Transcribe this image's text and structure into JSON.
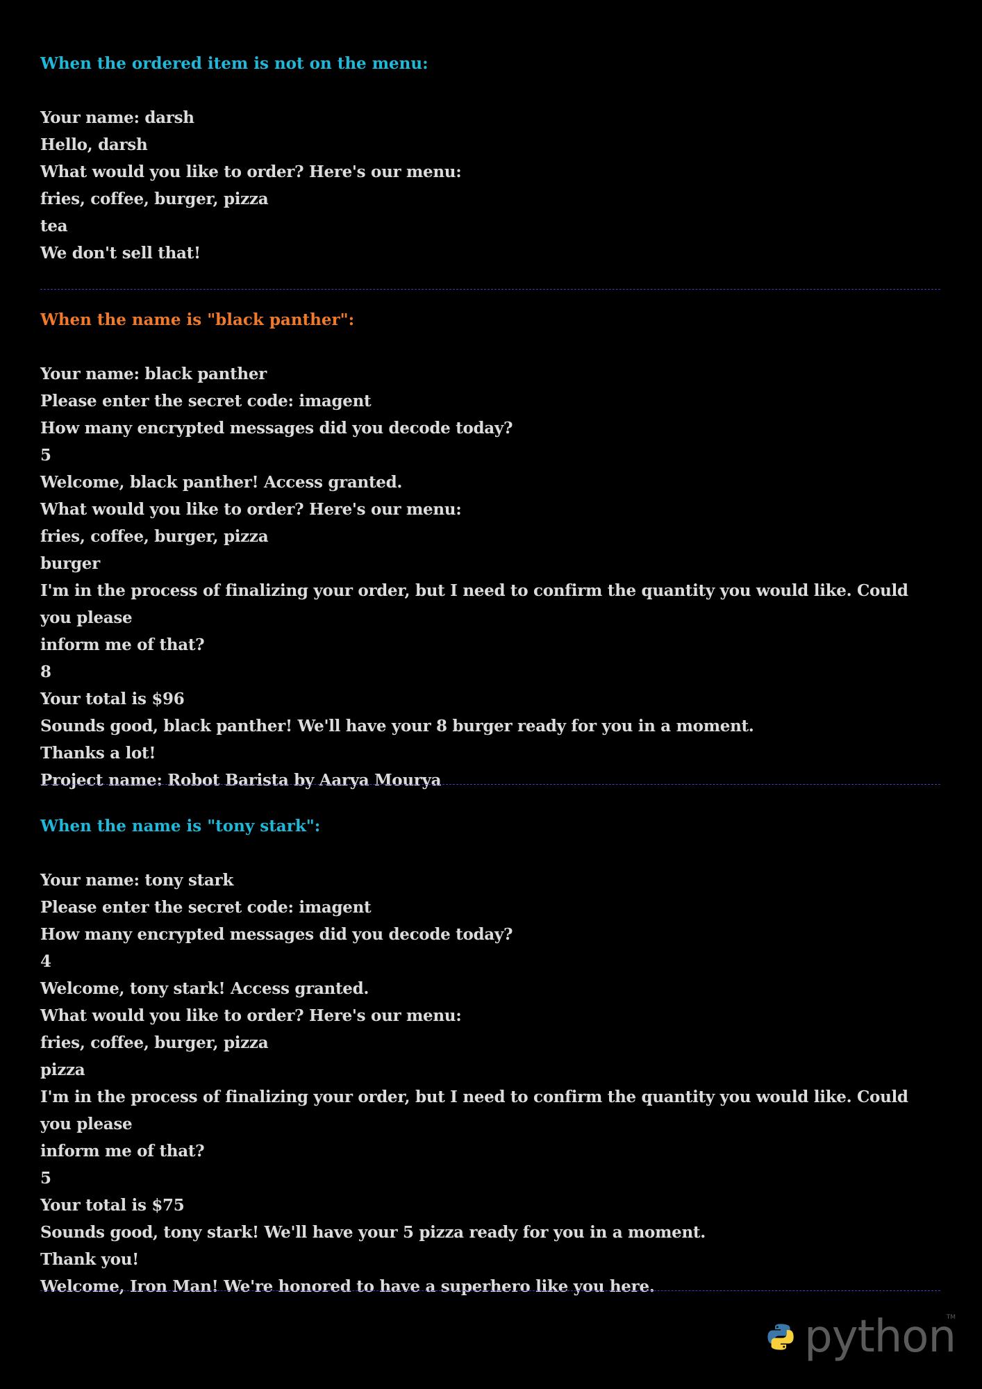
{
  "colors": {
    "heading_cyan": "#1fb8d9",
    "heading_orange": "#f07a2b",
    "divider": "#4b3bc7",
    "text": "#dcdcdc"
  },
  "sections": [
    {
      "heading": "When the ordered item is not on the menu:",
      "lines": [
        "Your name: darsh",
        "Hello, darsh",
        "What would you like to order? Here's our menu:",
        "fries, coffee, burger, pizza",
        "tea",
        "We don't sell that!"
      ]
    },
    {
      "heading": "When the name is \"black panther\":",
      "lines": [
        "Your name: black panther",
        "Please enter the secret code: imagent",
        "How many encrypted messages did you decode today?",
        "5",
        "Welcome, black panther! Access granted.",
        "What would you like to order? Here's our menu:",
        "fries, coffee, burger, pizza",
        "burger",
        "I'm in the process of finalizing your order, but I need to confirm the quantity you would like. Could you please",
        "inform me of that?",
        "8",
        "Your total is $96",
        "Sounds good, black panther! We'll have your 8 burger ready for you in a moment.",
        "Thanks a lot!",
        "Project name: Robot Barista by Aarya Mourya"
      ]
    },
    {
      "heading": "When the name is \"tony stark\":",
      "lines": [
        "Your name: tony stark",
        "Please enter the secret code: imagent",
        "How many encrypted messages did you decode today?",
        "4",
        "Welcome, tony stark! Access granted.",
        "What would you like to order? Here's our menu:",
        "fries, coffee, burger, pizza",
        "pizza",
        "I'm in the process of finalizing your order, but I need to confirm the quantity you would like. Could you please",
        "inform me of that?",
        "5",
        "Your total is $75",
        "Sounds good, tony stark! We'll have your 5 pizza ready for you in a moment.",
        "Thank you!",
        "Welcome, Iron Man! We're honored to have a superhero like you here."
      ]
    }
  ],
  "logo": {
    "word": "python",
    "tm": "TM",
    "icon": "python-logo-icon"
  }
}
